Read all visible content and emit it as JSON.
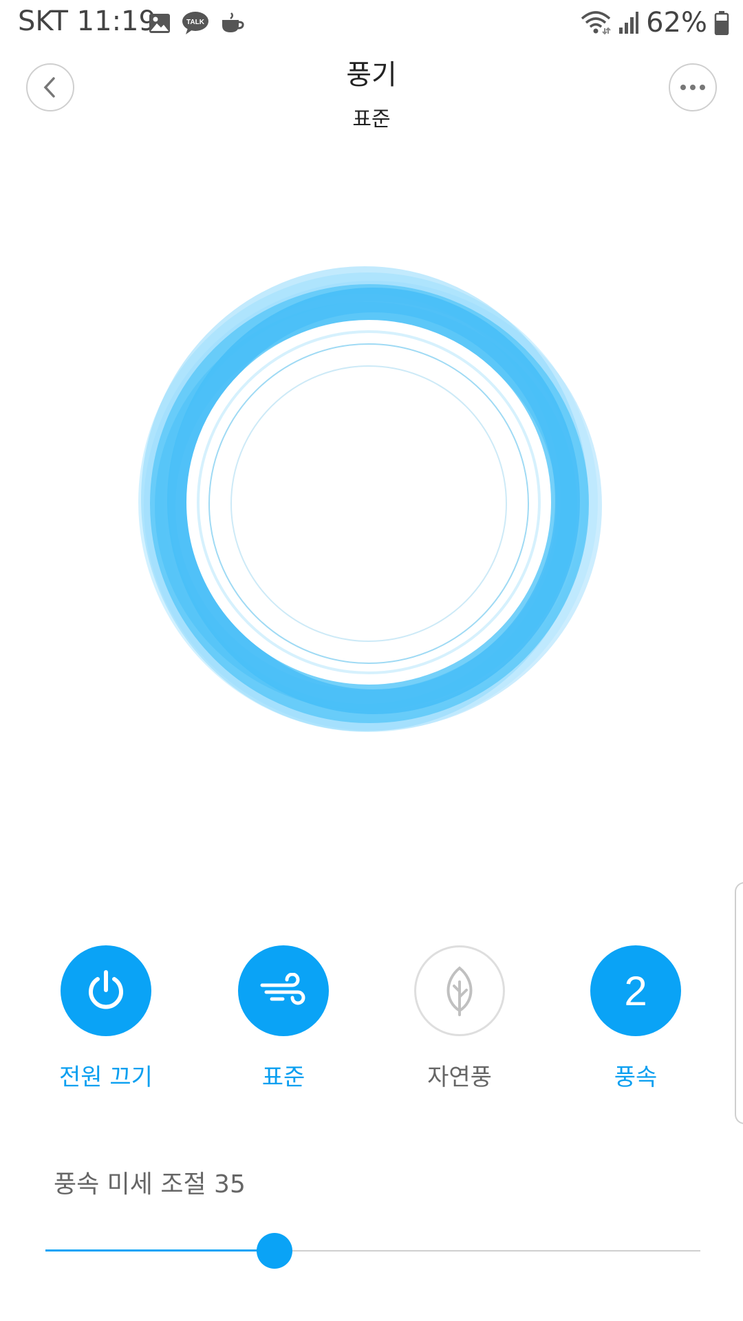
{
  "status_bar": {
    "carrier_time": "SKT 11:19",
    "battery_text": "62%",
    "left_icons": [
      "gallery-icon",
      "kakaotalk-icon",
      "cup-icon"
    ],
    "right_icons": [
      "wifi-icon",
      "signal-icon",
      "battery-icon"
    ]
  },
  "header": {
    "title": "풍기",
    "subtitle": "표준",
    "back_icon": "chevron-left-icon",
    "more_icon": "more-dots-icon"
  },
  "controls": [
    {
      "label": "전원 끄기",
      "icon": "power-icon",
      "active": true
    },
    {
      "label": "표준",
      "icon": "wind-icon",
      "active": true
    },
    {
      "label": "자연풍",
      "icon": "leaf-icon",
      "active": false
    },
    {
      "label": "풍속",
      "value": "2",
      "active": true
    }
  ],
  "fine_control": {
    "label": "풍속 미세 조절 35",
    "fill_fraction": 0.35
  },
  "colors": {
    "accent": "#0aa3f6",
    "ring": "#4fc3f7",
    "inactive": "#dedede"
  }
}
